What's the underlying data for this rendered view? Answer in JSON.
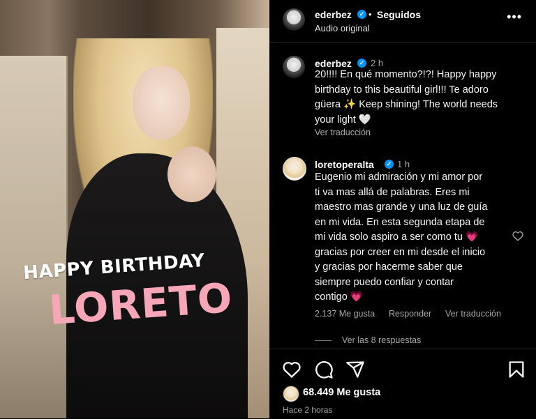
{
  "header": {
    "username": "ederbez",
    "separator": "•",
    "follow_status": "Seguidos",
    "subtitle": "Audio original",
    "more": "•••"
  },
  "media": {
    "caption_top": "HAPPY BIRTHDAY",
    "caption_name": "LORETO"
  },
  "post": {
    "author": "ederbez",
    "time": "2 h",
    "text_lines": [
      "20!!!! En qué momento?!?! Happy happy",
      "birthday to this beautiful girl!!! Te adoro",
      "güera ✨ Keep shining! The world needs",
      "your light 🤍"
    ],
    "translate": "Ver traducción"
  },
  "comment": {
    "author": "loretoperalta",
    "time": "1 h",
    "text_lines": [
      "Eugenio mi admiración y mi amor por",
      "ti va mas allá de palabras. Eres mi",
      "maestro mas grande y una luz de guía",
      "en mi vida. En esta segunda etapa de",
      "mi vida solo aspiro a ser como tu 💗",
      "gracias por creer en mi desde el inicio",
      "y gracias por hacerme saber que",
      "siempre puedo confiar y contar",
      "contigo 💗"
    ],
    "likes": "2.137 Me gusta",
    "reply": "Responder",
    "translate": "Ver traducción",
    "replies": "Ver las 8 respuestas"
  },
  "footer": {
    "likes": "68.449 Me gusta",
    "time_ago": "Hace 2 horas"
  },
  "colors": {
    "verified": "#0095f6",
    "pink_caption": "#f7a6b8"
  },
  "icons": [
    "heart-icon",
    "comment-icon",
    "share-icon",
    "bookmark-icon",
    "more-icon",
    "verified-badge-icon"
  ]
}
